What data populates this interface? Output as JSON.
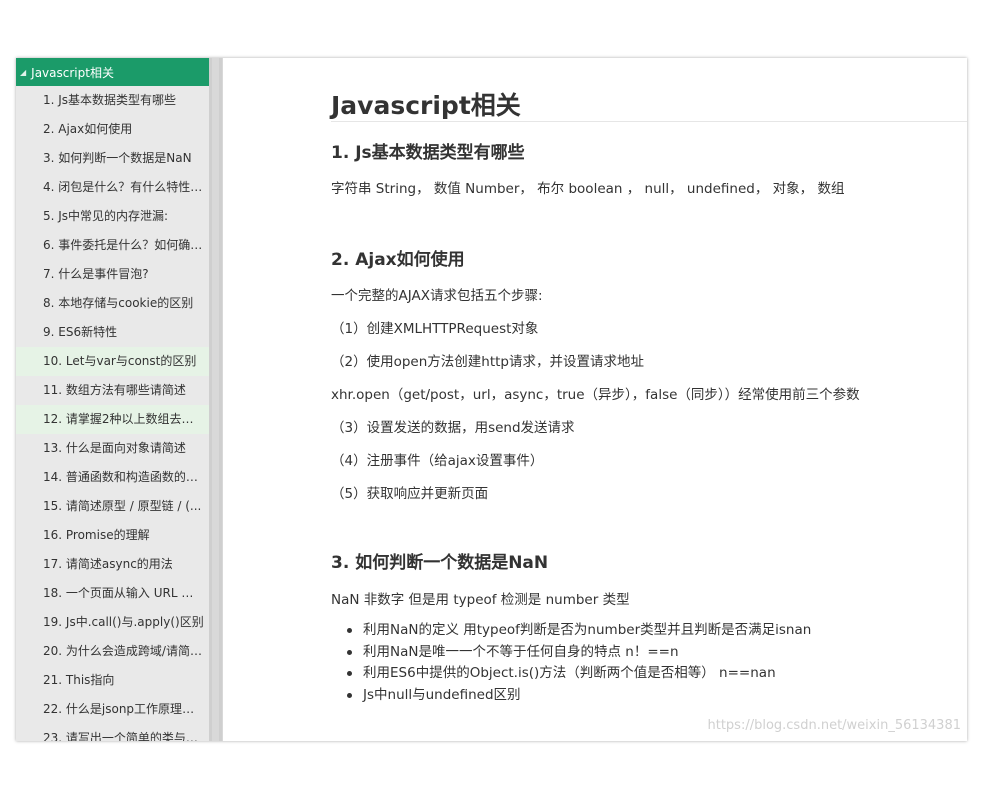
{
  "sidebar": {
    "header": "Javascript相关",
    "items": [
      "1. Js基本数据类型有哪些",
      "2. Ajax如何使用",
      "3. 如何判断一个数据是NaN",
      "4. 闭包是什么？有什么特性？...",
      "5. Js中常见的内存泄漏:",
      "6. 事件委托是什么？如何确定...",
      "7. 什么是事件冒泡?",
      "8. 本地存储与cookie的区别",
      "9. ES6新特性",
      "10. Let与var与const的区别",
      "11. 数组方法有哪些请简述",
      "12. 请掌握2种以上数组去重的...",
      "13. 什么是面向对象请简述",
      "14. 普通函数和构造函数的区别",
      "15. 请简述原型 / 原型链 / (...",
      "16. Promise的理解",
      "17. 请简述async的用法",
      "18. 一个页面从输入 URL 到页...",
      "19. Js中.call()与.apply()区别",
      "20. 为什么会造成跨域/请简述...",
      "21. This指向",
      "22. 什么是jsonp工作原理是什...",
      "23. 请写出一个简单的类与继承"
    ]
  },
  "content": {
    "title": "Javascript相关",
    "sections": [
      {
        "heading": "1. Js基本数据类型有哪些",
        "paragraphs": [
          "字符串 String， 数值 Number， 布尔 boolean ， null， undefined， 对象， 数组"
        ]
      },
      {
        "heading": "2. Ajax如何使用",
        "paragraphs": [
          "一个完整的AJAX请求包括五个步骤:",
          "（1）创建XMLHTTPRequest对象",
          "（2）使用open方法创建http请求，并设置请求地址",
          "xhr.open（get/post，url，async，true（异步），false（同步））经常使用前三个参数",
          "（3）设置发送的数据，用send发送请求",
          "（4）注册事件（给ajax设置事件）",
          "（5）获取响应并更新页面"
        ]
      },
      {
        "heading": "3. 如何判断一个数据是NaN",
        "paragraphs": [
          "NaN 非数字 但是用 typeof 检测是 number 类型"
        ],
        "bullets": [
          "利用NaN的定义  用typeof判断是否为number类型并且判断是否满足isnan",
          "利用NaN是唯一一个不等于任何自身的特点 n！==n",
          "利用ES6中提供的Object.is()方法（判断两个值是否相等）  n==nan",
          "Js中null与undefined区别"
        ]
      }
    ]
  },
  "watermark": "https://blog.csdn.net/weixin_56134381",
  "colors": {
    "accent": "#1b9b69",
    "highlight": "#e6f3e6"
  }
}
